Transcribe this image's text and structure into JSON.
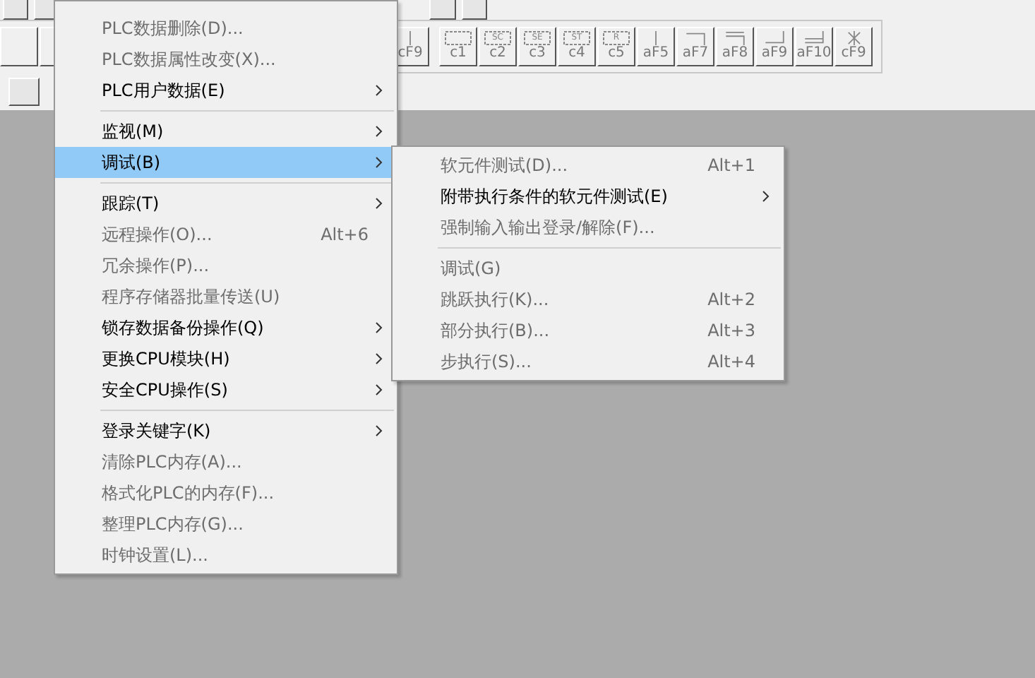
{
  "toolbar": {
    "function_keys": [
      {
        "kind": "vline",
        "label": "cF9"
      },
      {
        "kind": "bracket",
        "label": "c1"
      },
      {
        "kind": "bracket",
        "glyph": "SC",
        "label": "c2"
      },
      {
        "kind": "bracket",
        "glyph": "SE",
        "label": "c3"
      },
      {
        "kind": "bracket",
        "glyph": "ST",
        "label": "c4"
      },
      {
        "kind": "bracket",
        "glyph": "R",
        "label": "c5"
      },
      {
        "kind": "vline",
        "label": "aF5"
      },
      {
        "kind": "corner",
        "label": "aF7"
      },
      {
        "kind": "double-corner",
        "label": "aF8"
      },
      {
        "kind": "bottom-corner",
        "label": "aF9"
      },
      {
        "kind": "double-bottom",
        "label": "aF10"
      },
      {
        "kind": "cross",
        "label": "cF9"
      }
    ]
  },
  "menu": {
    "items": [
      {
        "kind": "item",
        "label": "PLC数据删除(D)...",
        "submenu": false,
        "disabled": true,
        "selected": false
      },
      {
        "kind": "item",
        "label": "PLC数据属性改变(X)...",
        "submenu": false,
        "disabled": true,
        "selected": false
      },
      {
        "kind": "item",
        "label": "PLC用户数据(E)",
        "submenu": true,
        "disabled": false,
        "selected": false
      },
      {
        "kind": "separator"
      },
      {
        "kind": "item",
        "label": "监视(M)",
        "submenu": true,
        "disabled": false,
        "selected": false
      },
      {
        "kind": "item",
        "label": "调试(B)",
        "submenu": true,
        "disabled": false,
        "selected": true
      },
      {
        "kind": "separator"
      },
      {
        "kind": "item",
        "label": "跟踪(T)",
        "submenu": true,
        "disabled": false,
        "selected": false
      },
      {
        "kind": "item",
        "label": "远程操作(O)...",
        "shortcut": "Alt+6",
        "submenu": false,
        "disabled": true,
        "selected": false
      },
      {
        "kind": "item",
        "label": "冗余操作(P)...",
        "submenu": false,
        "disabled": true,
        "selected": false
      },
      {
        "kind": "item",
        "label": "程序存储器批量传送(U)",
        "submenu": false,
        "disabled": true,
        "selected": false
      },
      {
        "kind": "item",
        "label": "锁存数据备份操作(Q)",
        "submenu": true,
        "disabled": false,
        "selected": false
      },
      {
        "kind": "item",
        "label": "更换CPU模块(H)",
        "submenu": true,
        "disabled": false,
        "selected": false
      },
      {
        "kind": "item",
        "label": "安全CPU操作(S)",
        "submenu": true,
        "disabled": false,
        "selected": false
      },
      {
        "kind": "separator"
      },
      {
        "kind": "item",
        "label": "登录关键字(K)",
        "submenu": true,
        "disabled": false,
        "selected": false
      },
      {
        "kind": "item",
        "label": "清除PLC内存(A)...",
        "submenu": false,
        "disabled": true,
        "selected": false
      },
      {
        "kind": "item",
        "label": "格式化PLC的内存(F)...",
        "submenu": false,
        "disabled": true,
        "selected": false
      },
      {
        "kind": "item",
        "label": "整理PLC内存(G)...",
        "submenu": false,
        "disabled": true,
        "selected": false
      },
      {
        "kind": "item",
        "label": "时钟设置(L)...",
        "submenu": false,
        "disabled": true,
        "selected": false
      }
    ]
  },
  "submenu": {
    "items": [
      {
        "kind": "item",
        "label": "软元件测试(D)...",
        "shortcut": "Alt+1",
        "submenu": false,
        "disabled": true,
        "selected": false
      },
      {
        "kind": "item",
        "label": "附带执行条件的软元件测试(E)",
        "submenu": true,
        "disabled": false,
        "selected": false
      },
      {
        "kind": "item",
        "label": "强制输入输出登录/解除(F)...",
        "submenu": false,
        "disabled": true,
        "selected": false
      },
      {
        "kind": "separator"
      },
      {
        "kind": "item",
        "label": "调试(G)",
        "submenu": false,
        "disabled": true,
        "selected": false
      },
      {
        "kind": "item",
        "label": "跳跃执行(K)...",
        "shortcut": "Alt+2",
        "submenu": false,
        "disabled": true,
        "selected": false
      },
      {
        "kind": "item",
        "label": "部分执行(B)...",
        "shortcut": "Alt+3",
        "submenu": false,
        "disabled": true,
        "selected": false
      },
      {
        "kind": "item",
        "label": "步执行(S)...",
        "shortcut": "Alt+4",
        "submenu": false,
        "disabled": true,
        "selected": false
      }
    ]
  }
}
